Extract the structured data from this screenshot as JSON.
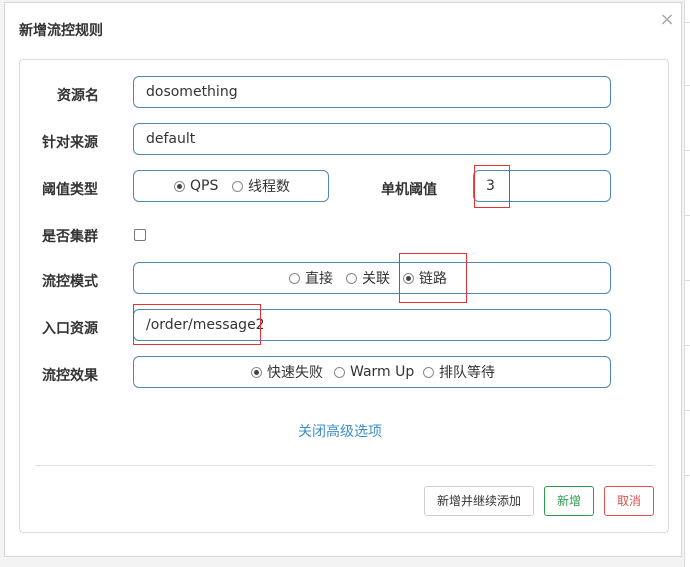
{
  "dialog": {
    "title": "新增流控规则",
    "close_glyph": "×"
  },
  "form": {
    "resource_name": {
      "label": "资源名",
      "value": "dosomething"
    },
    "limit_app": {
      "label": "针对来源",
      "value": "default"
    },
    "threshold_type": {
      "label": "阈值类型",
      "options": [
        "QPS",
        "线程数"
      ],
      "selected": "QPS"
    },
    "single_threshold": {
      "label": "单机阈值",
      "value": "3"
    },
    "cluster_mode": {
      "label": "是否集群",
      "checked": false
    },
    "strategy": {
      "label": "流控模式",
      "options": [
        "直接",
        "关联",
        "链路"
      ],
      "selected": "链路"
    },
    "entry_resource": {
      "label": "入口资源",
      "value": "/order/message2"
    },
    "control_behavior": {
      "label": "流控效果",
      "options": [
        "快速失败",
        "Warm Up",
        "排队等待"
      ],
      "selected": "快速失败"
    },
    "advanced_toggle": "关闭高级选项"
  },
  "footer": {
    "save_continue_label": "新增并继续添加",
    "add_label": "新增",
    "cancel_label": "取消"
  },
  "colors": {
    "input_border": "#4f87b8",
    "highlight": "#e33333",
    "link": "#3d8fc9",
    "success": "#2e9c4f",
    "danger": "#d9534f"
  }
}
